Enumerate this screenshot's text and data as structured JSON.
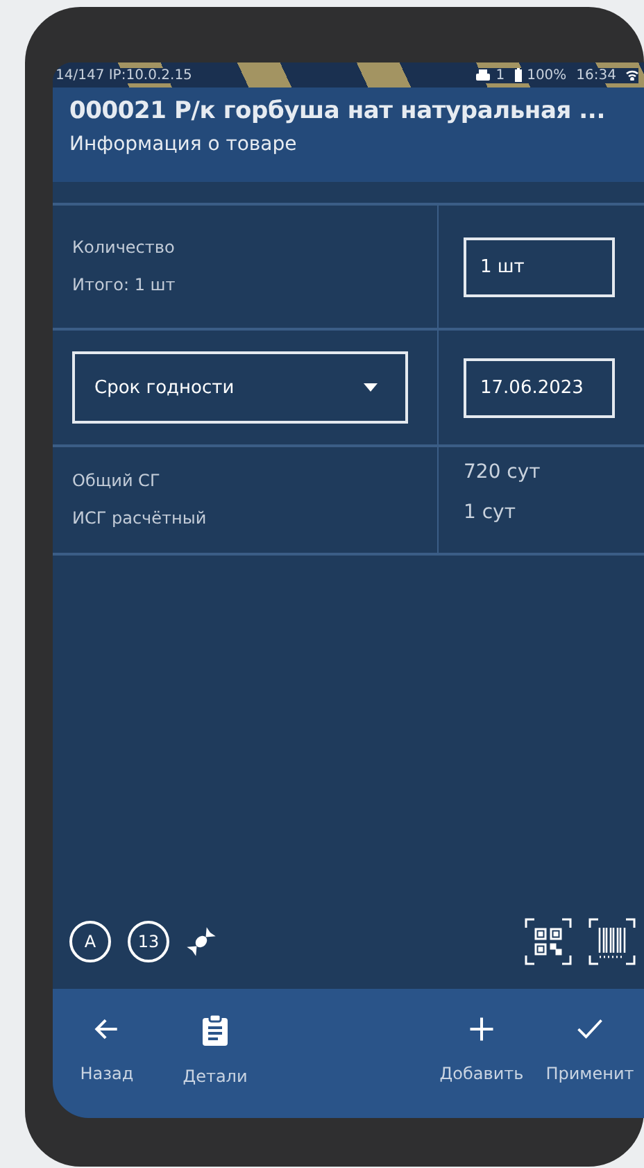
{
  "status_bar": {
    "left_text": "14/147 IP:10.0.2.15",
    "printer_count": "1",
    "battery": "100%",
    "time": "16:34"
  },
  "header": {
    "title": "000021 Р/к горбуша нат натуральная ...",
    "subtitle": "Информация о товаре"
  },
  "quantity": {
    "label": "Количество",
    "total": "Итого: 1 шт",
    "value": "1 шт"
  },
  "expiry": {
    "dropdown": "Срок годности",
    "value": "17.06.2023"
  },
  "shelf_life": [
    {
      "label": "Общий СГ",
      "value": "720 сут"
    },
    {
      "label": "ИСГ расчётный",
      "value": "1 сут"
    }
  ],
  "tool_icons": [
    {
      "kind": "circle",
      "text": "A"
    },
    {
      "kind": "circle",
      "text": "13"
    },
    {
      "kind": "candy"
    },
    {
      "kind": "qr"
    },
    {
      "kind": "barcode"
    }
  ],
  "nav": [
    {
      "kind": "back",
      "label": "Назад"
    },
    {
      "kind": "details",
      "label": "Детали"
    },
    {
      "kind": "add",
      "label": "Добавить"
    },
    {
      "kind": "apply",
      "label": "Применит"
    }
  ]
}
